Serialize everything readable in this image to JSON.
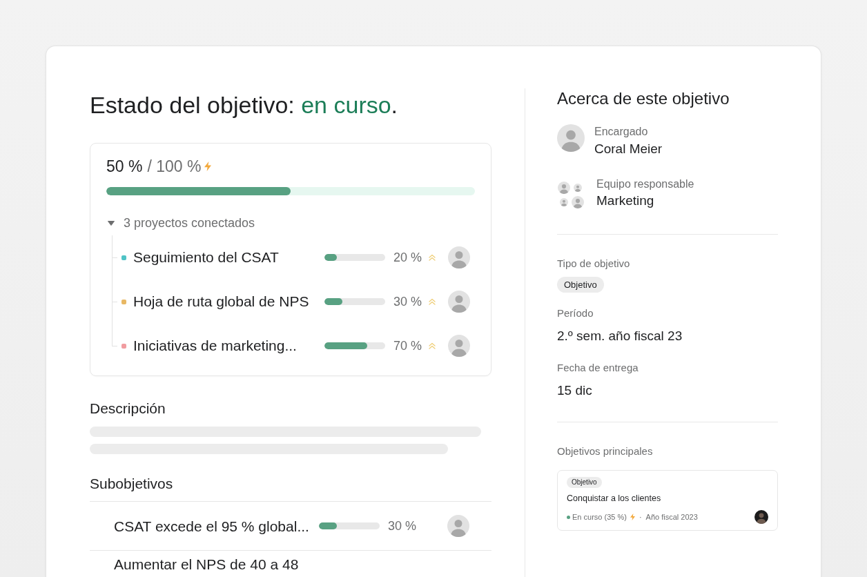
{
  "goal_status": {
    "label": "Estado del objetivo:",
    "status": "en curso",
    "end": "."
  },
  "progress": {
    "current": "50 %",
    "target": "/ 100 %",
    "level": 0.5,
    "projects": {
      "summary": "3 proyectos conectados",
      "expanded": true,
      "items": [
        {
          "name": "Seguimiento del CSAT",
          "color": "#4fc3c6",
          "level": 0.2,
          "percent": "20 %"
        },
        {
          "name": "Hoja de ruta global de NPS",
          "color": "#e8b864",
          "level": 0.3,
          "percent": "30 %"
        },
        {
          "name": "Iniciativas de marketing...",
          "color": "#f19ca0",
          "level": 0.7,
          "percent": "70 %"
        }
      ]
    }
  },
  "description": {
    "title": "Descripción"
  },
  "subgoals": {
    "title": "Subobjetivos",
    "items": [
      {
        "name": "CSAT excede el 95 % global...",
        "level": 0.3,
        "percent": "30 %"
      },
      {
        "name": "Aumentar el NPS de 40 a 48"
      }
    ]
  },
  "about": {
    "title": "Acerca de este objetivo",
    "owner": {
      "label": "Encargado",
      "name": "Coral Meier"
    },
    "team": {
      "label": "Equipo responsable",
      "name": "Marketing"
    },
    "fields": [
      {
        "label": "Tipo de objetivo",
        "kind": "chip",
        "value": "Objetivo"
      },
      {
        "label": "Período",
        "kind": "text",
        "value": "2.º sem. año fiscal 23"
      },
      {
        "label": "Fecha de entrega",
        "kind": "text",
        "value": "15 dic"
      }
    ],
    "parent_goals": {
      "label": "Objetivos principales",
      "items": [
        {
          "type": "Objetivo",
          "name": "Conquistar a los clientes",
          "status": "En curso (35 %)",
          "separator": "·",
          "period": "Año fiscal 2023"
        }
      ]
    }
  }
}
